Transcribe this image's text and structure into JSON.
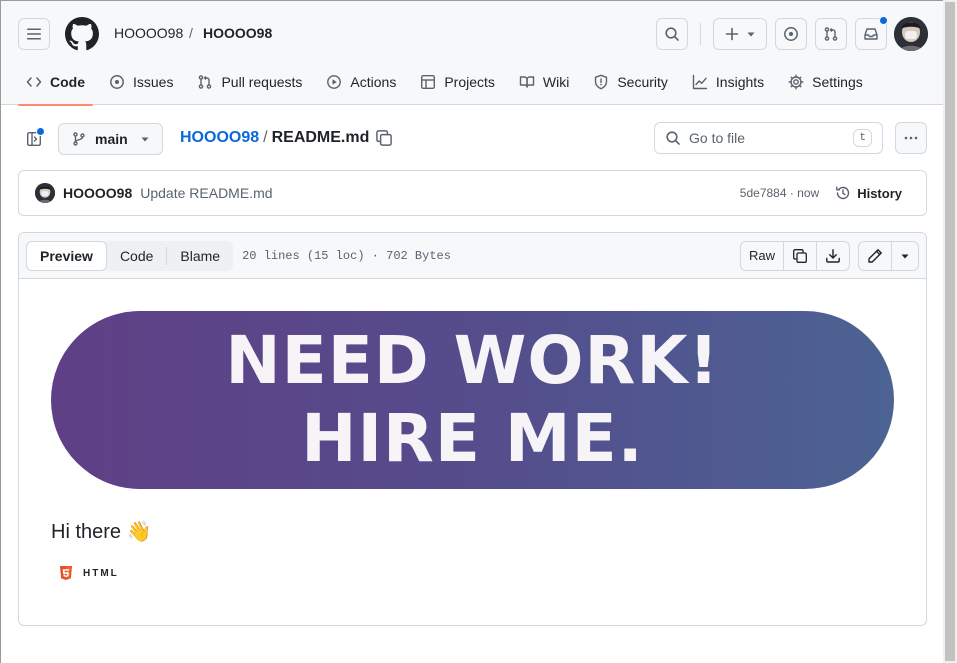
{
  "header": {
    "owner": "HOOOO98",
    "separator": "/",
    "repo": "HOOOO98"
  },
  "tabs": [
    {
      "label": "Code",
      "icon": "code-icon",
      "active": true
    },
    {
      "label": "Issues",
      "icon": "issue-icon"
    },
    {
      "label": "Pull requests",
      "icon": "pull-request-icon"
    },
    {
      "label": "Actions",
      "icon": "play-icon"
    },
    {
      "label": "Projects",
      "icon": "table-icon"
    },
    {
      "label": "Wiki",
      "icon": "book-icon"
    },
    {
      "label": "Security",
      "icon": "shield-icon"
    },
    {
      "label": "Insights",
      "icon": "graph-icon"
    },
    {
      "label": "Settings",
      "icon": "gear-icon"
    }
  ],
  "file_toolbar": {
    "branch": "main",
    "repo_link": "HOOOO98",
    "slash": "/",
    "file_name": "README.md",
    "goto_placeholder": "Go to file",
    "goto_shortcut": "t"
  },
  "commit": {
    "author": "HOOOO98",
    "message": "Update README.md",
    "meta": "5de7884 · now",
    "history_label": "History"
  },
  "file_view": {
    "tabs": {
      "preview": "Preview",
      "code": "Code",
      "blame": "Blame"
    },
    "info": "20 lines (15 loc) · 702 Bytes",
    "raw_label": "Raw"
  },
  "readme": {
    "banner_line1": "NEED WORK!",
    "banner_line2": "HIRE ME.",
    "greeting": "Hi there 👋",
    "badge_label": "HTML",
    "banner_colors": [
      "#5f3f85",
      "#4c6393"
    ]
  },
  "colors": {
    "accent": "#0969da",
    "active_tab_underline": "#fd8c73",
    "html_badge": "#e34f26"
  }
}
